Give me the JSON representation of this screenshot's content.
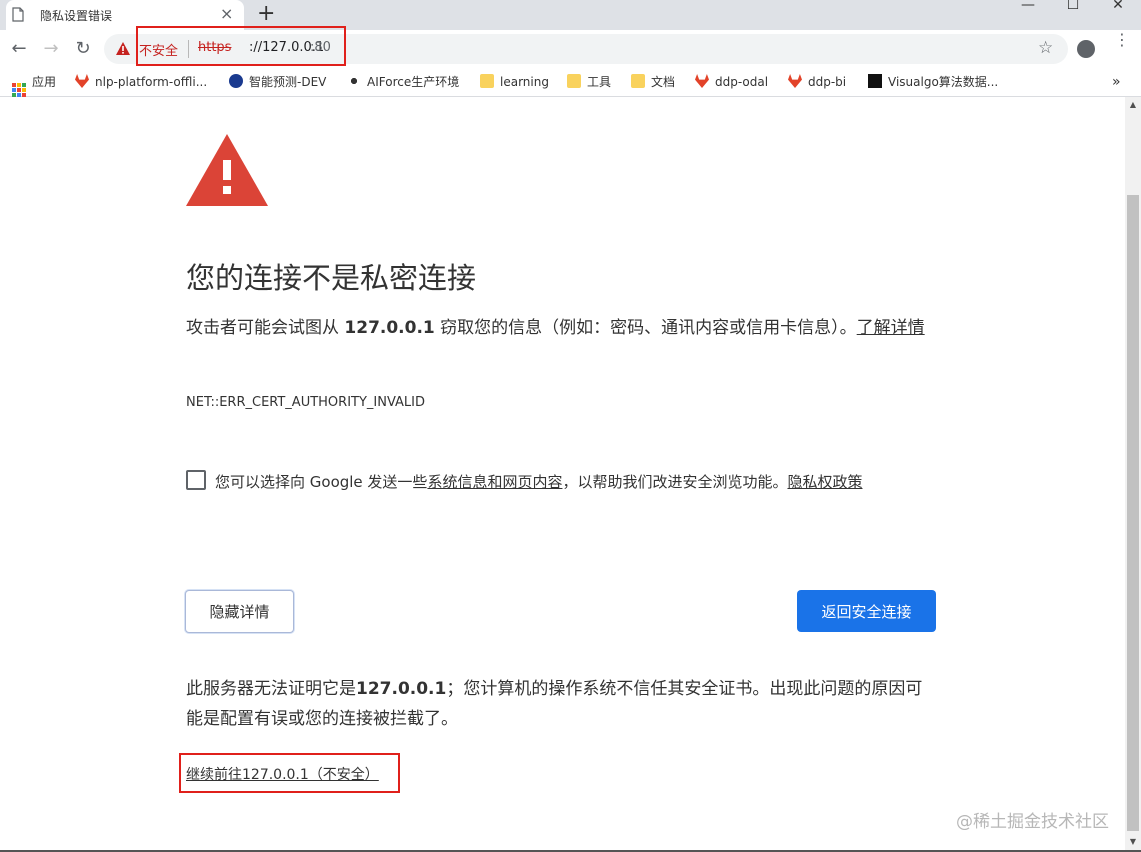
{
  "tab": {
    "title": "隐私设置错误",
    "close": "×",
    "new_tab": "+"
  },
  "window": {
    "minimize": "—",
    "maximize": "☐",
    "close": "✕"
  },
  "toolbar": {
    "back": "←",
    "forward": "→",
    "reload": "↻",
    "star": "☆",
    "menu": "⋮"
  },
  "address": {
    "insecure_label": "不安全",
    "scheme": "https",
    "host": "://127.0.0.1",
    "port": ":80"
  },
  "bookmarks": [
    {
      "label": "应用",
      "icon": "apps-grid-icon"
    },
    {
      "label": "nlp-platform-offli...",
      "icon": "gitlab-icon"
    },
    {
      "label": "智能预测-DEV",
      "icon": "zeta-logo-icon"
    },
    {
      "label": "AIForce生产环境",
      "icon": "network-icon"
    },
    {
      "label": "learning",
      "icon": "folder-icon"
    },
    {
      "label": "工具",
      "icon": "folder-icon"
    },
    {
      "label": "文档",
      "icon": "folder-icon"
    },
    {
      "label": "ddp-odal",
      "icon": "gitlab-icon"
    },
    {
      "label": "ddp-bi",
      "icon": "gitlab-icon"
    },
    {
      "label": "Visualgo算法数据...",
      "icon": "visualgo-icon"
    }
  ],
  "bookmarks_overflow": "»",
  "content": {
    "heading": "您的连接不是私密连接",
    "desc_prefix": "攻击者可能会试图从 ",
    "desc_host": "127.0.0.1",
    "desc_middle": " 窃取您的信息（例如：密码、通讯内容或信用卡信息）。",
    "learn_more": "了解详情",
    "error_code": "NET::ERR_CERT_AUTHORITY_INVALID",
    "checkbox_prefix": "您可以选择向 Google 发送一些",
    "checkbox_link1": "系统信息和网页内容",
    "checkbox_middle": "，以帮助我们改进安全浏览功能。",
    "checkbox_link2": "隐私权政策",
    "hide_details": "隐藏详情",
    "back_to_safety": "返回安全连接",
    "details_prefix": "此服务器无法证明它是",
    "details_host": "127.0.0.1",
    "details_suffix": "；您计算机的操作系统不信任其安全证书。出现此问题的原因可能是配置有误或您的连接被拦截了。",
    "proceed_link": "继续前往127.0.0.1（不安全）"
  },
  "watermark": "@稀土掘金技术社区",
  "colors": {
    "danger": "#db4437",
    "primary_button": "#1a73e8",
    "annotation_box": "#e0201b"
  }
}
